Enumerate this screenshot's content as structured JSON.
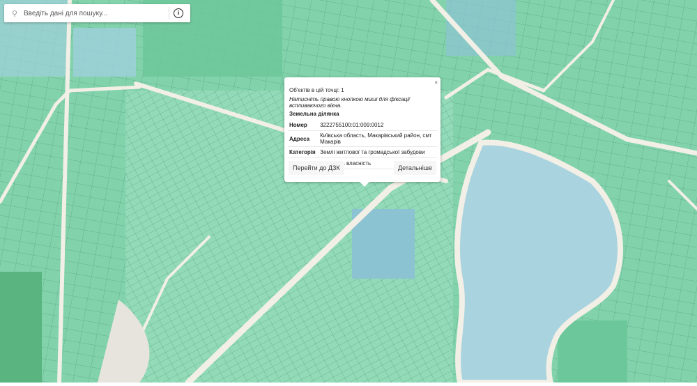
{
  "search": {
    "placeholder": "Введіть дані для пошуку...",
    "icon": "search-icon",
    "info_icon": "info-icon"
  },
  "popup": {
    "count": "Об'єктів в цій точці: 1",
    "hint": "Натисніть правою кнопкою миші для фіксації вспливаючого вікна.",
    "close": "×",
    "title": "Земельна ділянка",
    "rows": [
      {
        "key": "Номер",
        "value": "3222755100:01:009:0012"
      },
      {
        "key": "Адреса",
        "value": "Київська область, Макарівський район, смт Макарів"
      },
      {
        "key": "Категорія",
        "value": "Землі житлової та громадської забудови"
      },
      {
        "key": "Власність",
        "value": "Приватна власність"
      }
    ],
    "btn_dzk": "Перейти до ДЗК",
    "btn_details": "Детальніше"
  },
  "colors": {
    "parcel": "#8fd9b5",
    "parcel_dark": "#6cc79a",
    "water": "#a9d3df",
    "road": "#f2efe6",
    "blue_parcel": "#8cc3d3"
  }
}
